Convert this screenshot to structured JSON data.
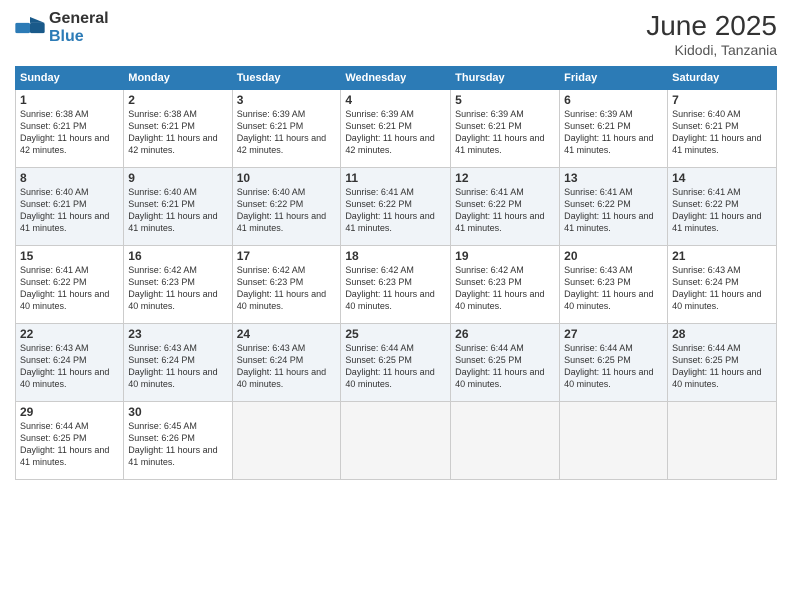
{
  "header": {
    "logo_general": "General",
    "logo_blue": "Blue",
    "month": "June 2025",
    "location": "Kidodi, Tanzania"
  },
  "weekdays": [
    "Sunday",
    "Monday",
    "Tuesday",
    "Wednesday",
    "Thursday",
    "Friday",
    "Saturday"
  ],
  "weeks": [
    [
      {
        "day": "1",
        "info": "Sunrise: 6:38 AM\nSunset: 6:21 PM\nDaylight: 11 hours and 42 minutes."
      },
      {
        "day": "2",
        "info": "Sunrise: 6:38 AM\nSunset: 6:21 PM\nDaylight: 11 hours and 42 minutes."
      },
      {
        "day": "3",
        "info": "Sunrise: 6:39 AM\nSunset: 6:21 PM\nDaylight: 11 hours and 42 minutes."
      },
      {
        "day": "4",
        "info": "Sunrise: 6:39 AM\nSunset: 6:21 PM\nDaylight: 11 hours and 42 minutes."
      },
      {
        "day": "5",
        "info": "Sunrise: 6:39 AM\nSunset: 6:21 PM\nDaylight: 11 hours and 41 minutes."
      },
      {
        "day": "6",
        "info": "Sunrise: 6:39 AM\nSunset: 6:21 PM\nDaylight: 11 hours and 41 minutes."
      },
      {
        "day": "7",
        "info": "Sunrise: 6:40 AM\nSunset: 6:21 PM\nDaylight: 11 hours and 41 minutes."
      }
    ],
    [
      {
        "day": "8",
        "info": "Sunrise: 6:40 AM\nSunset: 6:21 PM\nDaylight: 11 hours and 41 minutes."
      },
      {
        "day": "9",
        "info": "Sunrise: 6:40 AM\nSunset: 6:21 PM\nDaylight: 11 hours and 41 minutes."
      },
      {
        "day": "10",
        "info": "Sunrise: 6:40 AM\nSunset: 6:22 PM\nDaylight: 11 hours and 41 minutes."
      },
      {
        "day": "11",
        "info": "Sunrise: 6:41 AM\nSunset: 6:22 PM\nDaylight: 11 hours and 41 minutes."
      },
      {
        "day": "12",
        "info": "Sunrise: 6:41 AM\nSunset: 6:22 PM\nDaylight: 11 hours and 41 minutes."
      },
      {
        "day": "13",
        "info": "Sunrise: 6:41 AM\nSunset: 6:22 PM\nDaylight: 11 hours and 41 minutes."
      },
      {
        "day": "14",
        "info": "Sunrise: 6:41 AM\nSunset: 6:22 PM\nDaylight: 11 hours and 41 minutes."
      }
    ],
    [
      {
        "day": "15",
        "info": "Sunrise: 6:41 AM\nSunset: 6:22 PM\nDaylight: 11 hours and 40 minutes."
      },
      {
        "day": "16",
        "info": "Sunrise: 6:42 AM\nSunset: 6:23 PM\nDaylight: 11 hours and 40 minutes."
      },
      {
        "day": "17",
        "info": "Sunrise: 6:42 AM\nSunset: 6:23 PM\nDaylight: 11 hours and 40 minutes."
      },
      {
        "day": "18",
        "info": "Sunrise: 6:42 AM\nSunset: 6:23 PM\nDaylight: 11 hours and 40 minutes."
      },
      {
        "day": "19",
        "info": "Sunrise: 6:42 AM\nSunset: 6:23 PM\nDaylight: 11 hours and 40 minutes."
      },
      {
        "day": "20",
        "info": "Sunrise: 6:43 AM\nSunset: 6:23 PM\nDaylight: 11 hours and 40 minutes."
      },
      {
        "day": "21",
        "info": "Sunrise: 6:43 AM\nSunset: 6:24 PM\nDaylight: 11 hours and 40 minutes."
      }
    ],
    [
      {
        "day": "22",
        "info": "Sunrise: 6:43 AM\nSunset: 6:24 PM\nDaylight: 11 hours and 40 minutes."
      },
      {
        "day": "23",
        "info": "Sunrise: 6:43 AM\nSunset: 6:24 PM\nDaylight: 11 hours and 40 minutes."
      },
      {
        "day": "24",
        "info": "Sunrise: 6:43 AM\nSunset: 6:24 PM\nDaylight: 11 hours and 40 minutes."
      },
      {
        "day": "25",
        "info": "Sunrise: 6:44 AM\nSunset: 6:25 PM\nDaylight: 11 hours and 40 minutes."
      },
      {
        "day": "26",
        "info": "Sunrise: 6:44 AM\nSunset: 6:25 PM\nDaylight: 11 hours and 40 minutes."
      },
      {
        "day": "27",
        "info": "Sunrise: 6:44 AM\nSunset: 6:25 PM\nDaylight: 11 hours and 40 minutes."
      },
      {
        "day": "28",
        "info": "Sunrise: 6:44 AM\nSunset: 6:25 PM\nDaylight: 11 hours and 40 minutes."
      }
    ],
    [
      {
        "day": "29",
        "info": "Sunrise: 6:44 AM\nSunset: 6:25 PM\nDaylight: 11 hours and 41 minutes."
      },
      {
        "day": "30",
        "info": "Sunrise: 6:45 AM\nSunset: 6:26 PM\nDaylight: 11 hours and 41 minutes."
      },
      {
        "day": "",
        "info": ""
      },
      {
        "day": "",
        "info": ""
      },
      {
        "day": "",
        "info": ""
      },
      {
        "day": "",
        "info": ""
      },
      {
        "day": "",
        "info": ""
      }
    ]
  ]
}
